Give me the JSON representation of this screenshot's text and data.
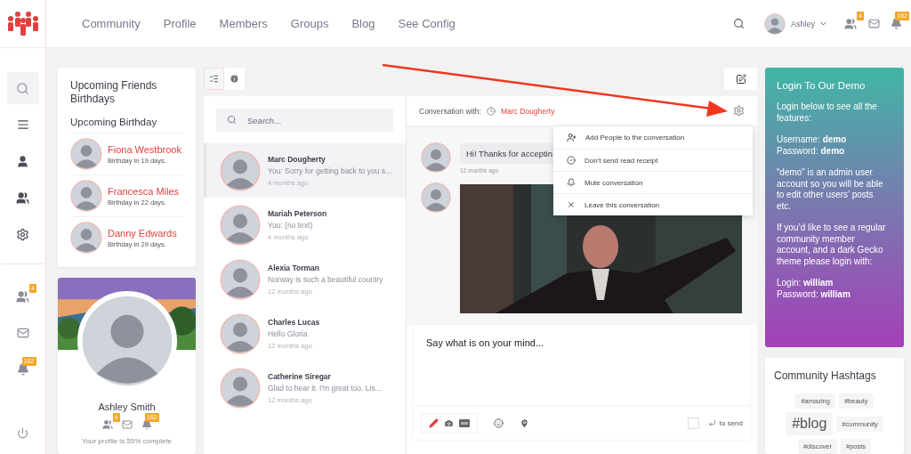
{
  "nav": {
    "items": [
      {
        "label": "Community"
      },
      {
        "label": "Profile"
      },
      {
        "label": "Members"
      },
      {
        "label": "Groups"
      },
      {
        "label": "Blog"
      },
      {
        "label": "See Config"
      }
    ],
    "user": "Ashley",
    "friend_badge": "4",
    "notification_badge": "162"
  },
  "rail": {
    "items": [
      {
        "kind": "search",
        "selected": true
      },
      {
        "kind": "activity",
        "selected": false
      },
      {
        "kind": "profile",
        "selected": false
      },
      {
        "kind": "members",
        "selected": false
      },
      {
        "kind": "settings",
        "selected": false
      }
    ],
    "friend_badge": "4",
    "notification_badge": "162"
  },
  "birthdays": {
    "title": "Upcoming Friends Birthdays",
    "subtitle": "Upcoming Birthday",
    "people": [
      {
        "name": "Fiona Westbrook",
        "when": "Birthday in 19 days."
      },
      {
        "name": "Francesca Miles",
        "when": "Birthday in 22 days."
      },
      {
        "name": "Danny Edwards",
        "when": "Birthday in 29 days."
      }
    ]
  },
  "profile": {
    "name": "Ashley Smith",
    "friend_badge": "4",
    "notification_badge": "162",
    "completion": "Your profile is 55% complete"
  },
  "messages": {
    "search": {
      "placeholder": "Search..."
    },
    "conversations": [
      {
        "name": "Marc Dougherty",
        "preview": "You: Sorry for getting back to you s...",
        "time": "4 months ago",
        "selected": true
      },
      {
        "name": "Mariah Peterson",
        "preview": "You: (no text)",
        "time": "4 months ago",
        "selected": false
      },
      {
        "name": "Alexia Torman",
        "preview": "Norway is such a beautiful country",
        "time": "12 months ago",
        "selected": false
      },
      {
        "name": "Charles Lucas",
        "preview": "Hello Gloria",
        "time": "12 months ago",
        "selected": false
      },
      {
        "name": "Catherine Siregar",
        "preview": "Glad to hear it. I'm great too. Lis...",
        "time": "12 months ago",
        "selected": false
      }
    ]
  },
  "conversation": {
    "label": "Conversation with:",
    "partner": "Marc Dougherty",
    "thread": [
      {
        "kind": "text",
        "text": "Hi! Thanks for acceptin",
        "time": "12 months ago"
      },
      {
        "kind": "picture"
      }
    ],
    "menu": [
      {
        "kind": "add",
        "label": "Add People to the conversation"
      },
      {
        "kind": "receipt",
        "label": "Don't send read receipt"
      },
      {
        "kind": "mute",
        "label": "Mute conversation"
      },
      {
        "kind": "leave",
        "label": "Leave this conversation"
      }
    ],
    "composer": {
      "placeholder": "Say what is on your mind...",
      "enter_to_send": false,
      "enter_label": "to send"
    }
  },
  "login_card": {
    "title": "Login To Our Demo",
    "paragraphs": [
      [
        "Login below to see all the features:"
      ],
      [
        "Username: **demo**",
        "Password: **demo**"
      ],
      [
        "“demo” is an admin user account so you will be able to edit other users’ posts etc."
      ],
      [
        "If you’d like to see a regular community member account, and a dark Gecko theme please login with:"
      ],
      [
        "Login: **william**",
        "Password: **william**"
      ]
    ]
  },
  "hashtags": {
    "title": "Community Hashtags",
    "tags": [
      {
        "label": "#amazing",
        "kind": "small"
      },
      {
        "label": "#beauty",
        "kind": "small"
      },
      {
        "label": "#blog",
        "kind": "large"
      },
      {
        "label": "#community",
        "kind": "small"
      },
      {
        "label": "#discover",
        "kind": "small"
      },
      {
        "label": "#posts",
        "kind": "small"
      }
    ]
  }
}
